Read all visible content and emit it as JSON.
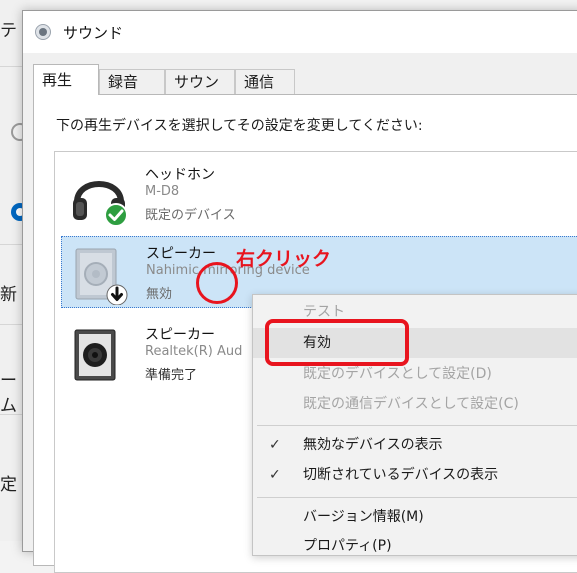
{
  "background_app": {
    "fragments": [
      "テ",
      "新",
      "ーム",
      "定"
    ]
  },
  "dialog": {
    "title": "サウンド",
    "tabs": [
      {
        "label": "再生",
        "active": true
      },
      {
        "label": "録音",
        "active": false
      },
      {
        "label": "サウンド",
        "active": false
      },
      {
        "label": "通信",
        "active": false
      }
    ],
    "instruction": "下の再生デバイスを選択してその設定を変更してください:",
    "devices": [
      {
        "name": "ヘッドホン",
        "description": "M-D8",
        "status": "既定のデバイス",
        "icon": "headphones-icon",
        "badge": "green-check-badge"
      },
      {
        "name": "スピーカー",
        "description": "Nahimic mirroring device",
        "status": "無効",
        "icon": "speaker-icon",
        "badge": "disabled-arrow-badge",
        "selected": true
      },
      {
        "name": "スピーカー",
        "description": "Realtek(R) Aud",
        "status": "準備完了",
        "icon": "speaker-icon"
      }
    ]
  },
  "context_menu": {
    "items": [
      {
        "label": "テスト",
        "disabled": true
      },
      {
        "label": "有効",
        "disabled": false,
        "highlighted": true
      },
      {
        "label": "既定のデバイスとして設定(D)",
        "disabled": true
      },
      {
        "label": "既定の通信デバイスとして設定(C)",
        "disabled": true
      },
      {
        "label": "無効なデバイスの表示",
        "checked": true
      },
      {
        "label": "切断されているデバイスの表示",
        "checked": true
      },
      {
        "label": "バージョン情報(M)"
      },
      {
        "label": "プロパティ(P)"
      }
    ]
  },
  "annotations": {
    "right_click_label": "右クリック",
    "color": "#e8141e"
  },
  "colors": {
    "selection": "#cce4f7",
    "accent": "#0067c0",
    "check_badge": "#2e9e40"
  }
}
